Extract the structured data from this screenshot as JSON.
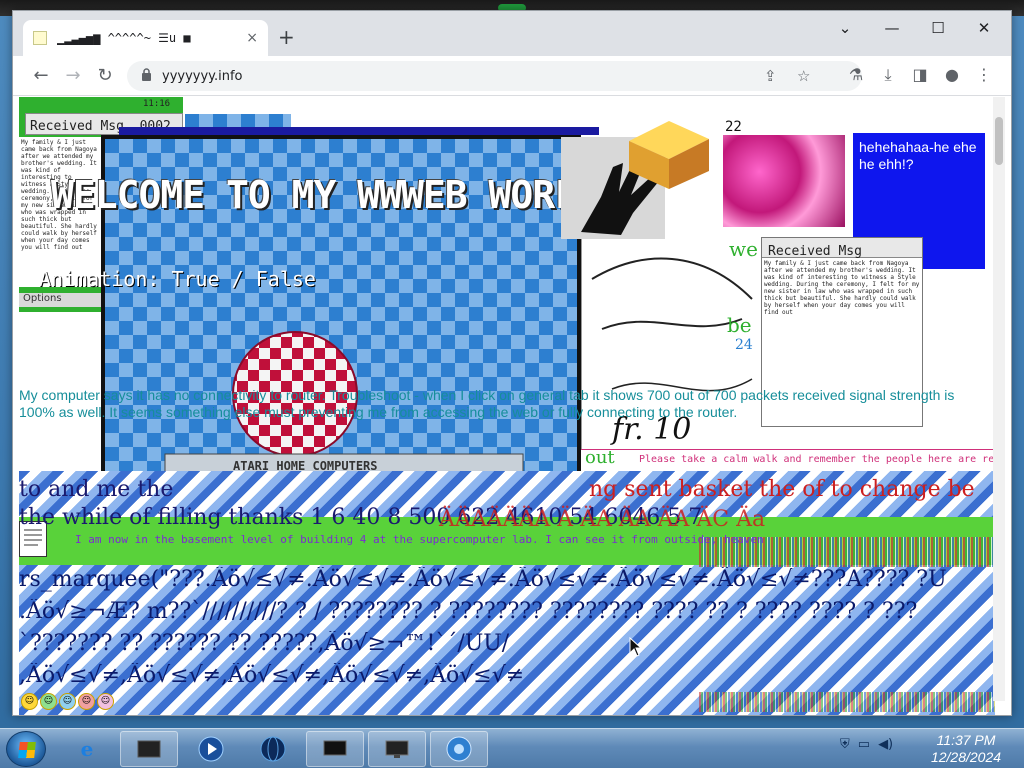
{
  "browser": {
    "tab_title": "▁▂▃▄▅▆ ^^^^^~ ☰u ■",
    "url": "yyyyyyy.info",
    "new_tab_label": "+",
    "close_tab_label": "×",
    "window_controls": {
      "chevron": "⌄",
      "minimize": "—",
      "maximize": "☐",
      "close": "✕"
    },
    "nav": {
      "back": "←",
      "forward": "→",
      "reload": "↻",
      "lock": "🔒"
    },
    "toolbar_icons": [
      "share-icon",
      "star-icon",
      "labs-icon",
      "download-icon",
      "sidebar-icon",
      "profile-icon",
      "menu-icon"
    ]
  },
  "page": {
    "received_msg_1": "Received Msg. 0002",
    "received_msg_2": "Received Msg",
    "small_time": "11:16",
    "welcome": "WELCOME TO MY  WWWEB WORLD",
    "animation": "Animation: True / False",
    "options_label": "Options",
    "atari_label": "ATARI HOME COMPUTERS",
    "counter": "22",
    "blue_box_text": "hehehahaa-he ehe he ehh!?",
    "num_24": "24",
    "teal_paragraph": "My computer says it has no connectivity to router. Troubleshoot - when I click on general tab it shows 700 out of 700 packets received signal strength is 100% as well. It seems something else must preventing me from accessing the web or fully connecting to the router.",
    "pink_note": "Please take a calm walk and remember the people here are real",
    "basement_line": "I am now in the basement level of building 4 at the supercomputer lab. I can see it from outside, heaven",
    "serif_line_1": "to and me the",
    "red_line_1": "ng sent basket the of to change be",
    "serif_line_2": "the while of filling thanks 1 6 40 8 500 622 4610 54 6046 5 7",
    "red_line_2": "ÄÄAÄÄÄA Ä ÄA ÄA ÄA ÄC Äa",
    "letter_text": "My family & I just came back from Nagoya after we attended my brother's wedding. It was kind of interesting to witness a Style wedding. During the ceremony, I felt for my new sister in law who was wrapped in such thick but beautiful. She hardly could walk by herself when your day comes you will find out",
    "marquee_1": "rs_marquee(\"???.Äö√≤√≠.Äö√≤√≠.Äö√≤√≠.Äö√≤√≠.Äö√≤√≠.Äö√≤√≠???A???? ?U",
    "marquee_2": ".Äö√≥¬Æ? m??`//////////? ? / ???????? ? ???????? ???????? ???? ?? ? ???? ???? ? ???",
    "marquee_3": "`???????            ??            ??????            ??                        ?????,Äö√≥¬™!`´/UU/",
    "marquee_4": ",Äö√≤√≠,Äö√≤√≠,Äö√≤√≠,Äö√≤√≠,Äö√≤√≠",
    "tr_signs": "we",
    "out_label": "out",
    "be_label": "be"
  },
  "taskbar": {
    "time": "11:37 PM",
    "date": "12/28/2024",
    "apps": [
      "ie-icon",
      "terminal-icon",
      "media-player-icon",
      "globe-icon",
      "monitor-icon",
      "network-monitor-icon",
      "browser-icon"
    ]
  },
  "colors": {
    "accent_green": "#2fb02f",
    "blue_box": "#0e16ee",
    "teal_text": "#168e9a",
    "taskbar": "#5f8ab8"
  }
}
